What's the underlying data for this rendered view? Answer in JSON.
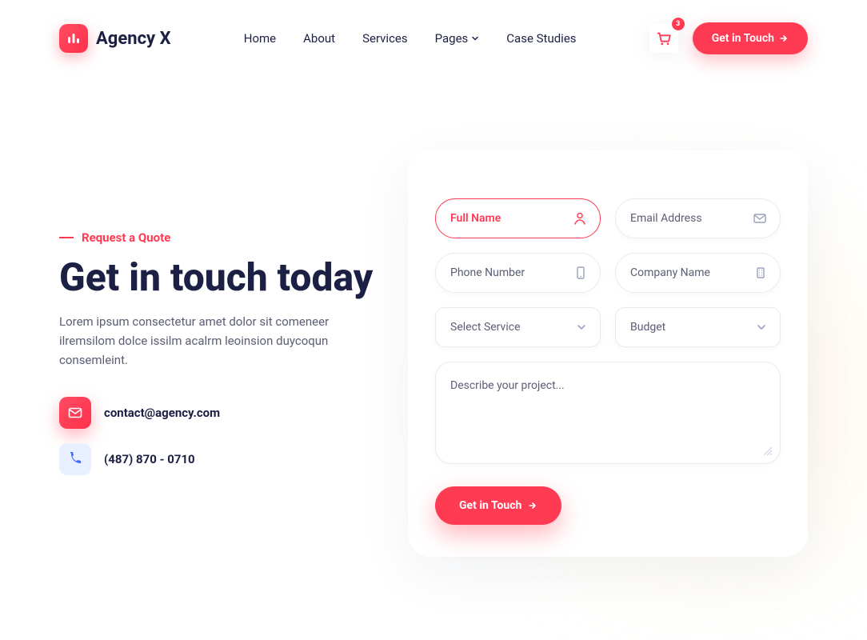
{
  "header": {
    "brand": "Agency X",
    "nav": [
      "Home",
      "About",
      "Services",
      "Pages",
      "Case Studies"
    ],
    "cart_count": "3",
    "cta": "Get in Touch"
  },
  "hero": {
    "eyebrow": "Request a Quote",
    "title": "Get in touch today",
    "description": "Lorem ipsum consectetur amet dolor sit comeneer ilremsilom dolce issilm acalrm leoinsion duycoqun consemleint.",
    "email": "contact@agency.com",
    "phone": "(487) 870 - 0710"
  },
  "form": {
    "full_name": "Full Name",
    "email": "Email Address",
    "phone": "Phone Number",
    "company": "Company Name",
    "service": "Select Service",
    "budget": "Budget",
    "message": "Describe your project...",
    "submit": "Get in Touch"
  }
}
